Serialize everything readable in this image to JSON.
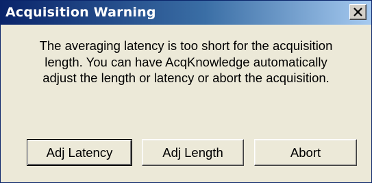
{
  "window": {
    "title": "Acquisition Warning"
  },
  "message": {
    "line1": "The averaging latency is too short for the acquisition",
    "line2": "length. You can have AcqKnowledge automatically",
    "line3": "adjust the length or latency or abort the acquisition."
  },
  "buttons": {
    "adj_latency": "Adj Latency",
    "adj_length": "Adj Length",
    "abort": "Abort"
  },
  "icons": {
    "close": "close-icon"
  },
  "colors": {
    "title_start": "#0a246a",
    "title_end": "#a6caf0",
    "dialog_bg": "#ece9d8"
  }
}
